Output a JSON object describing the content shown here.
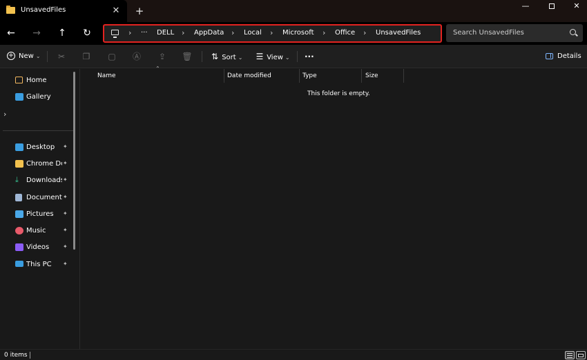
{
  "tab": {
    "title": "UnsavedFiles",
    "close_glyph": "✕",
    "add_glyph": "+"
  },
  "window_controls": {
    "minimize": "—",
    "close": "✕"
  },
  "nav": {
    "back": "←",
    "forward": "→",
    "up": "↑",
    "refresh": "↻"
  },
  "address": {
    "more": "···",
    "segments": [
      "DELL",
      "AppData",
      "Local",
      "Microsoft",
      "Office",
      "UnsavedFiles"
    ],
    "chevron": "›",
    "highlight_color": "#e42320"
  },
  "search": {
    "placeholder": "Search UnsavedFiles"
  },
  "commands": {
    "new_label": "New",
    "sort_label": "Sort",
    "view_label": "View",
    "more": "···",
    "details_label": "Details",
    "cut_icon": "scissors-icon",
    "copy_icon": "copy-icon",
    "paste_icon": "paste-icon",
    "rename_icon": "rename-icon",
    "share_icon": "share-icon",
    "delete_icon": "trash-icon"
  },
  "sidebar": {
    "top_items": [
      {
        "label": "Home",
        "icon": "home-icon"
      },
      {
        "label": "Gallery",
        "icon": "gallery-icon"
      }
    ],
    "pinned_items": [
      {
        "label": "Desktop",
        "icon": "desktop-icon",
        "color": "#3a9de0"
      },
      {
        "label": "Chrome Downloads",
        "icon": "folder-icon",
        "color": "#f2c14e"
      },
      {
        "label": "Downloads",
        "icon": "download-icon",
        "color": "#38c191"
      },
      {
        "label": "Documents",
        "icon": "documents-icon",
        "color": "#9fb7d6"
      },
      {
        "label": "Pictures",
        "icon": "pictures-icon",
        "color": "#4aa8e8"
      },
      {
        "label": "Music",
        "icon": "music-icon",
        "color": "#e85a6a"
      },
      {
        "label": "Videos",
        "icon": "videos-icon",
        "color": "#8b5cf6"
      },
      {
        "label": "This PC",
        "icon": "this-pc-icon",
        "color": "#3a9de0"
      }
    ],
    "pin_glyph": "📌"
  },
  "columns": [
    "Name",
    "Date modified",
    "Type",
    "Size"
  ],
  "empty_message": "This folder is empty.",
  "status": {
    "items": "0 items"
  }
}
